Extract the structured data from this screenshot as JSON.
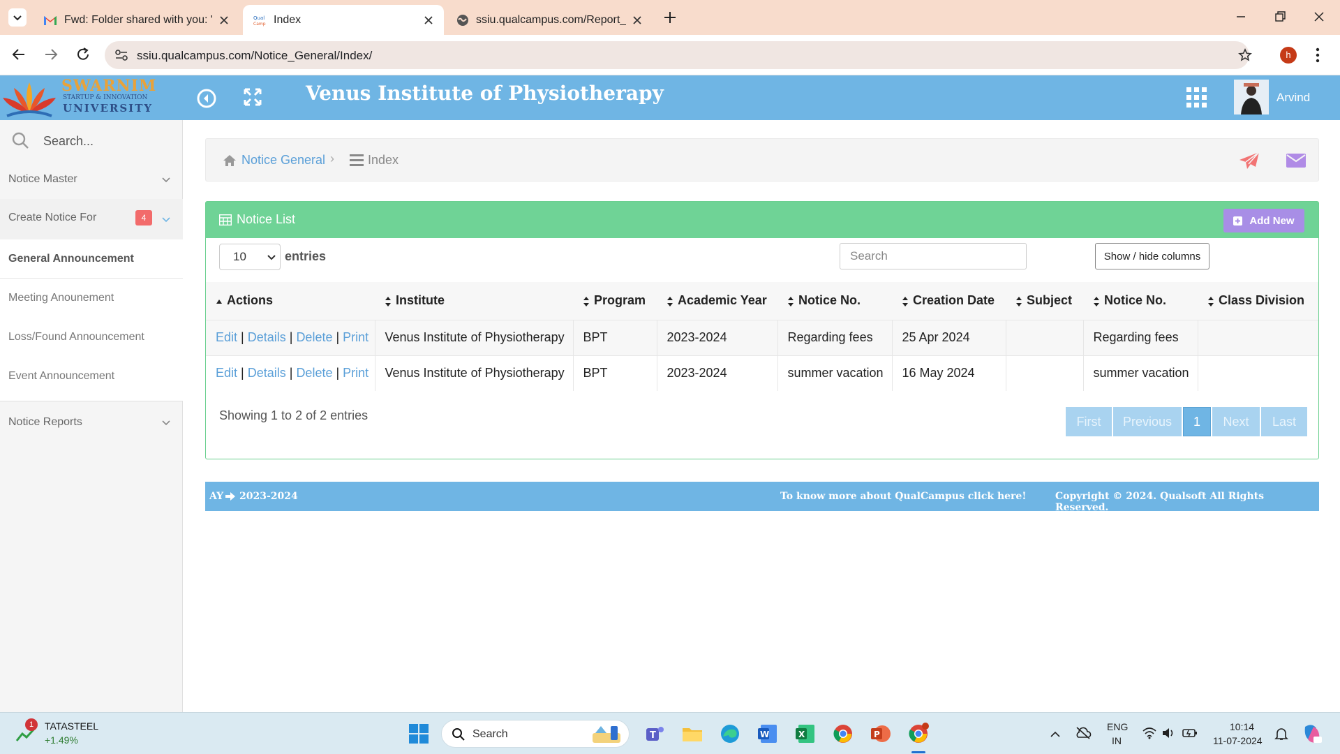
{
  "browser": {
    "tabs": [
      {
        "title": "Fwd: Folder shared with you: \"A",
        "icon": "gmail-icon"
      },
      {
        "title": "Index",
        "icon": "qualcampus-favicon",
        "active": true
      },
      {
        "title": "ssiu.qualcampus.com/Report_V",
        "icon": "globe-icon"
      }
    ],
    "url": "ssiu.qualcampus.com/Notice_General/Index/",
    "profile_initial": "h"
  },
  "header": {
    "title": "Venus Institute of Physiotherapy",
    "user_name": "Arvind",
    "logo_text": "SWARNIM",
    "logo_sub1": "STARTUP & INNOVATION",
    "logo_sub2": "UNIVERSITY"
  },
  "sidebar": {
    "search_placeholder": "Search...",
    "items": [
      {
        "label": "Notice Master"
      },
      {
        "label": "Create Notice For",
        "badge": "4"
      },
      {
        "label": "General Announcement"
      },
      {
        "label": "Meeting Anounement"
      },
      {
        "label": "Loss/Found Announcement"
      },
      {
        "label": "Event Announcement"
      },
      {
        "label": "Notice Reports"
      }
    ]
  },
  "breadcrumb": {
    "home": "Notice General",
    "current": "Index"
  },
  "panel": {
    "title": "Notice List",
    "add_new": "Add New",
    "entries_value": "10",
    "entries_label": "entries",
    "search_placeholder": "Search",
    "colvis": "Show / hide columns"
  },
  "table": {
    "columns": [
      "Actions",
      "Institute",
      "Program",
      "Academic Year",
      "Notice No.",
      "Creation Date",
      "Subject",
      "Notice No.",
      "Class Division"
    ],
    "action_links": [
      "Edit",
      "Details",
      "Delete",
      "Print"
    ],
    "rows": [
      {
        "institute": "Venus Institute of Physiotherapy",
        "program": "BPT",
        "year": "2023-2024",
        "notice_no": "Regarding fees",
        "date": "25 Apr 2024",
        "subject": "",
        "notice_no2": "Regarding fees",
        "division": ""
      },
      {
        "institute": "Venus Institute of Physiotherapy",
        "program": "BPT",
        "year": "2023-2024",
        "notice_no": "summer vacation",
        "date": "16 May 2024",
        "subject": "",
        "notice_no2": "summer vacation",
        "division": ""
      }
    ],
    "showing": "Showing 1 to 2 of 2 entries"
  },
  "pagination": {
    "first": "First",
    "previous": "Previous",
    "current": "1",
    "next": "Next",
    "last": "Last"
  },
  "footer": {
    "ay_label": "AY",
    "ay_value": "2023-2024",
    "more": "To know more about QualCampus click here!",
    "copyright": "Copyright © 2024. Qualsoft All Rights Reserved."
  },
  "taskbar": {
    "stock_name": "TATASTEEL",
    "stock_change": "+1.49%",
    "stock_badge": "1",
    "search": "Search",
    "lang1": "ENG",
    "lang2": "IN",
    "time": "10:14",
    "date": "11-07-2024"
  },
  "colors": {
    "header_blue": "#6fb5e4",
    "panel_green": "#6fd396",
    "add_new_purple": "#a88ee6",
    "badge_red": "#f26b6b",
    "link_blue": "#5a9fd8"
  }
}
